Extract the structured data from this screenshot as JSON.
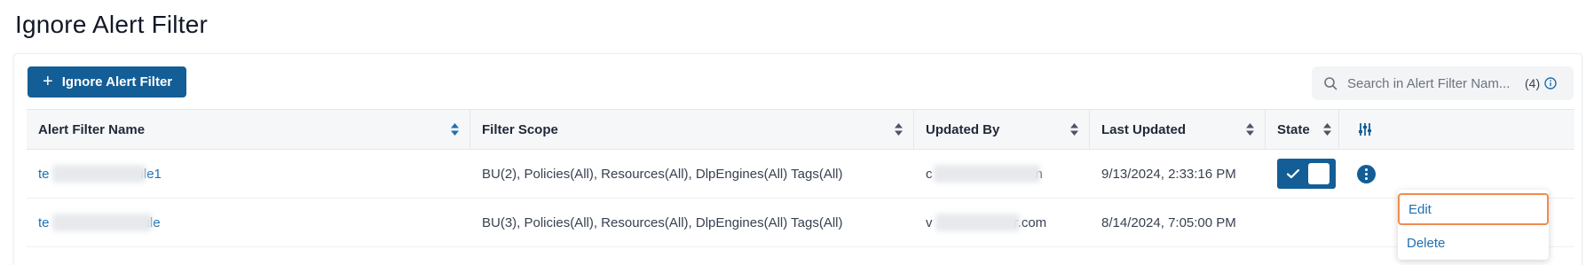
{
  "page": {
    "title": "Ignore Alert Filter"
  },
  "toolbar": {
    "add_label": "Ignore Alert Filter"
  },
  "search": {
    "placeholder": "Search in Alert Filter Nam...",
    "count": "(4)"
  },
  "table": {
    "columns": [
      "Alert Filter Name",
      "Filter Scope",
      "Updated By",
      "Last Updated",
      "State"
    ],
    "rows": [
      {
        "name_visible_start": "te",
        "name_visible_end": "ule1",
        "scope": "BU(2), Policies(All), Resources(All), DlpEngines(All) Tags(All)",
        "updated_by_visible_start": "c",
        "updated_by_visible_end": "n",
        "last_updated": "9/13/2024, 2:33:16 PM",
        "state": "on"
      },
      {
        "name_visible_start": "te",
        "name_visible_end": "ule",
        "scope": "BU(3), Policies(All), Resources(All), DlpEngines(All) Tags(All)",
        "updated_by_visible_start": "v",
        "updated_by_visible_end": "r.com",
        "last_updated": "8/14/2024, 7:05:00 PM",
        "state": ""
      }
    ]
  },
  "menu": {
    "edit": "Edit",
    "delete": "Delete"
  },
  "colors": {
    "primary": "#135e96",
    "link": "#1f6fb0",
    "focus": "#ef8c50"
  },
  "icons": {
    "add": "plus-icon",
    "search": "search-icon",
    "info": "info-icon",
    "sort": "sort-icon",
    "settings": "sliders-icon",
    "toggle": "check-icon",
    "actions": "kebab-icon"
  }
}
